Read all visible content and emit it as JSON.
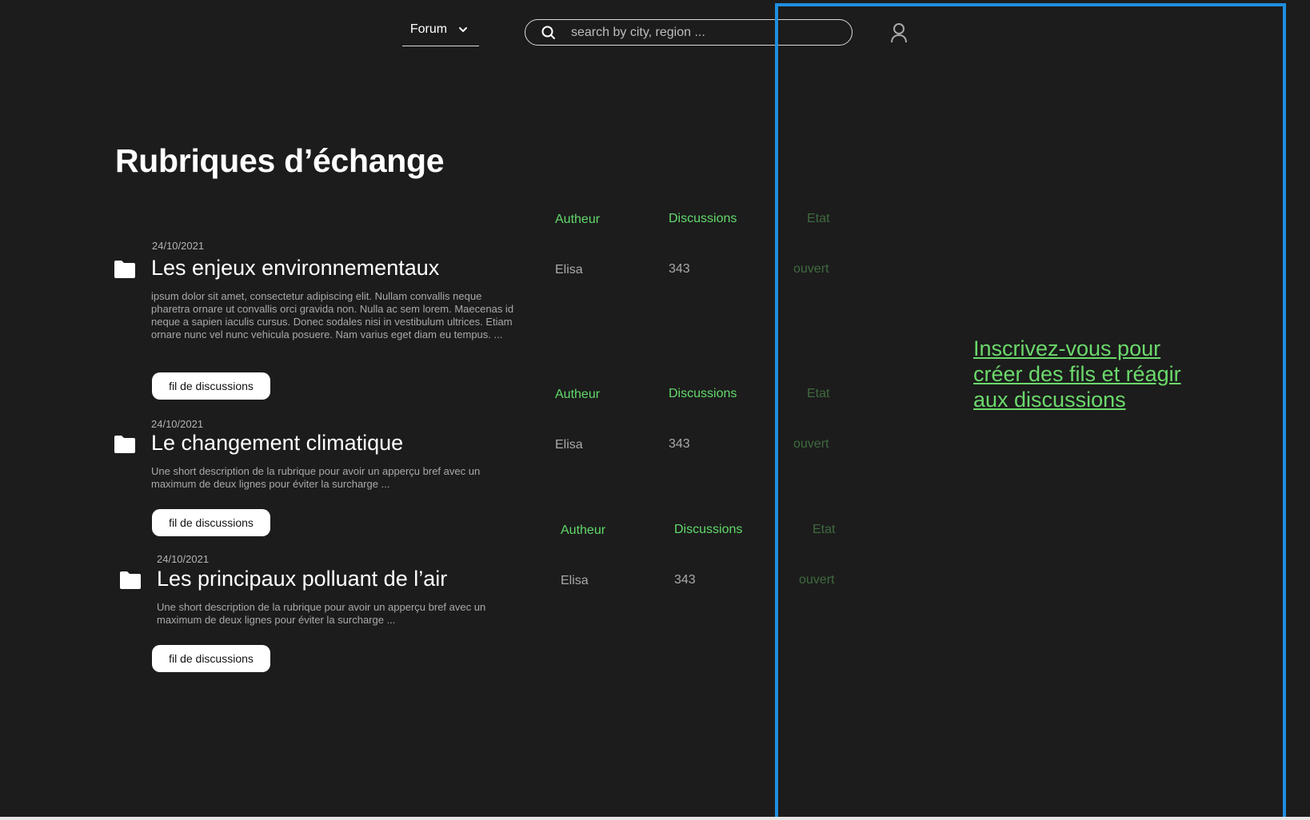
{
  "header": {
    "forum_label": "Forum",
    "search_placeholder": "search by city, region ..."
  },
  "page_title": "Rubriques d’échange",
  "columns": {
    "author": "Autheur",
    "discussions": "Discussions",
    "state": "Etat"
  },
  "rubrics": [
    {
      "date": "24/10/2021",
      "title": "Les enjeux environnementaux",
      "description": "ipsum dolor sit amet, consectetur adipiscing elit. Nullam convallis neque pharetra ornare ut convallis orci gravida non. Nulla ac sem lorem. Maecenas id neque a sapien iaculis cursus. Donec sodales nisi in vestibulum ultrices. Etiam ornare nunc vel nunc vehicula posuere. Nam varius eget diam eu tempus.  ...",
      "author": "Elisa",
      "discussions": "343",
      "state": "ouvert",
      "button_label": "fil de discussions"
    },
    {
      "date": "24/10/2021",
      "title": "Le changement climatique",
      "description": "Une short description de la rubrique pour avoir un apperçu bref avec un maximum de deux lignes pour éviter la surcharge ...",
      "author": "Elisa",
      "discussions": "343",
      "state": "ouvert",
      "button_label": "fil de discussions"
    },
    {
      "date": "24/10/2021",
      "title": "Les principaux polluant de l’air",
      "description": "Une short description de la rubrique pour avoir un apperçu bref avec un maximum de deux lignes pour éviter la surcharge ...",
      "author": "Elisa",
      "discussions": "343",
      "state": "ouvert",
      "button_label": "fil de discussions"
    }
  ],
  "sidebar": {
    "signup_text": "Inscrivez-vous pour créer des fils et réagir aux discussions"
  },
  "colors": {
    "background": "#1c1c1c",
    "accent_green": "#62d96b",
    "selection_blue": "#1e8fe0"
  },
  "icons": {
    "forum_chevron": "chevron-down-icon",
    "search": "search-icon",
    "user": "user-icon",
    "rubric": "folder-icon"
  }
}
